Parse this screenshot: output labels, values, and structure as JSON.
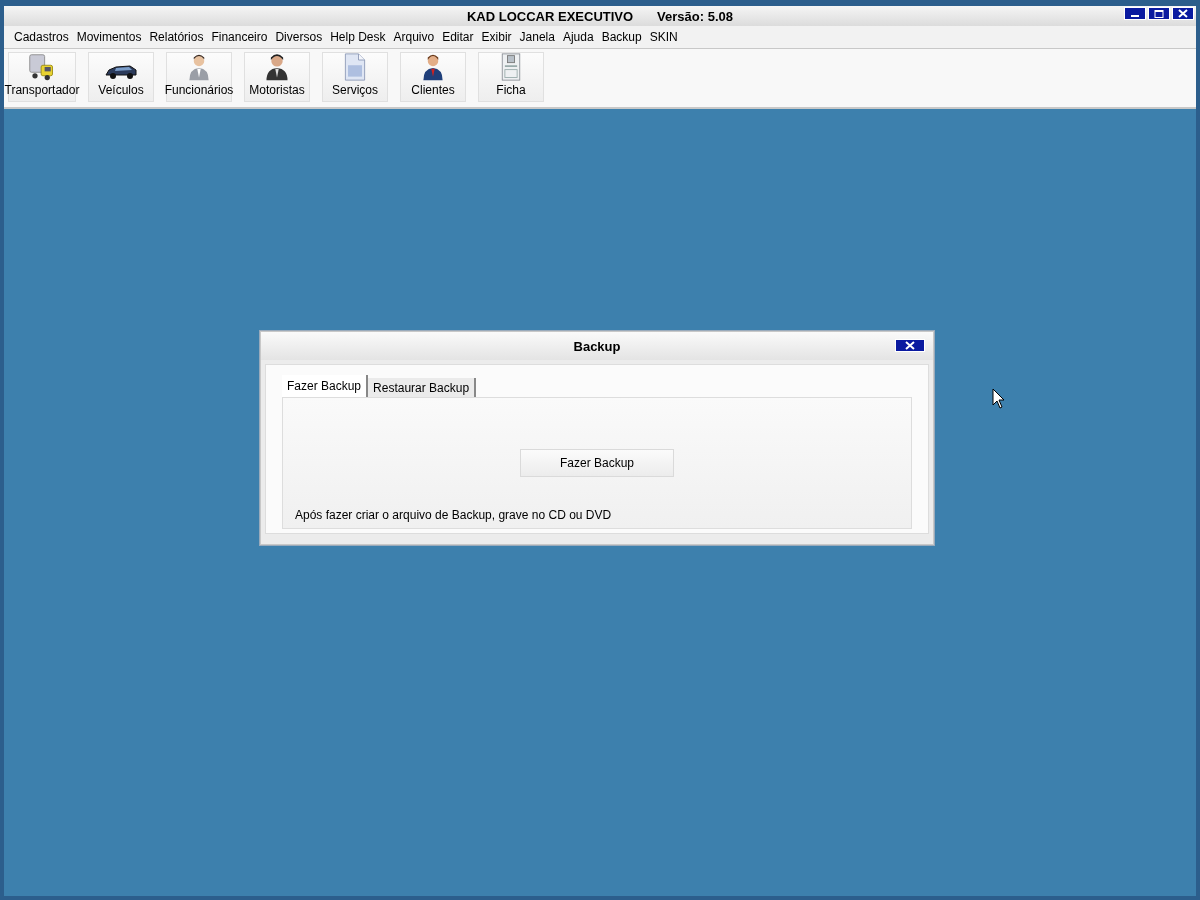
{
  "window": {
    "title": "KAD LOCCAR EXECUTIVO",
    "version": "Versão: 5.08"
  },
  "menu": [
    "Cadastros",
    "Movimentos",
    "Relatórios",
    "Financeiro",
    "Diversos",
    "Help Desk",
    "Arquivo",
    "Editar",
    "Exibir",
    "Janela",
    "Ajuda",
    "Backup",
    "SKIN"
  ],
  "toolbar": [
    {
      "label": "Transportador",
      "kind": "truck"
    },
    {
      "label": "Veículos",
      "kind": "car"
    },
    {
      "label": "Funcionários",
      "kind": "person"
    },
    {
      "label": "Motoristas",
      "kind": "person-dark"
    },
    {
      "label": "Serviços",
      "kind": "document"
    },
    {
      "label": "Clientes",
      "kind": "person-suit"
    },
    {
      "label": "Ficha",
      "kind": "form"
    }
  ],
  "dialog": {
    "title": "Backup",
    "tabs": [
      {
        "label": "Fazer Backup",
        "selected": true
      },
      {
        "label": "Restaurar Backup",
        "selected": false
      }
    ],
    "button": "Fazer Backup",
    "note": "Após fazer criar o arquivo de Backup, grave no CD ou DVD"
  }
}
